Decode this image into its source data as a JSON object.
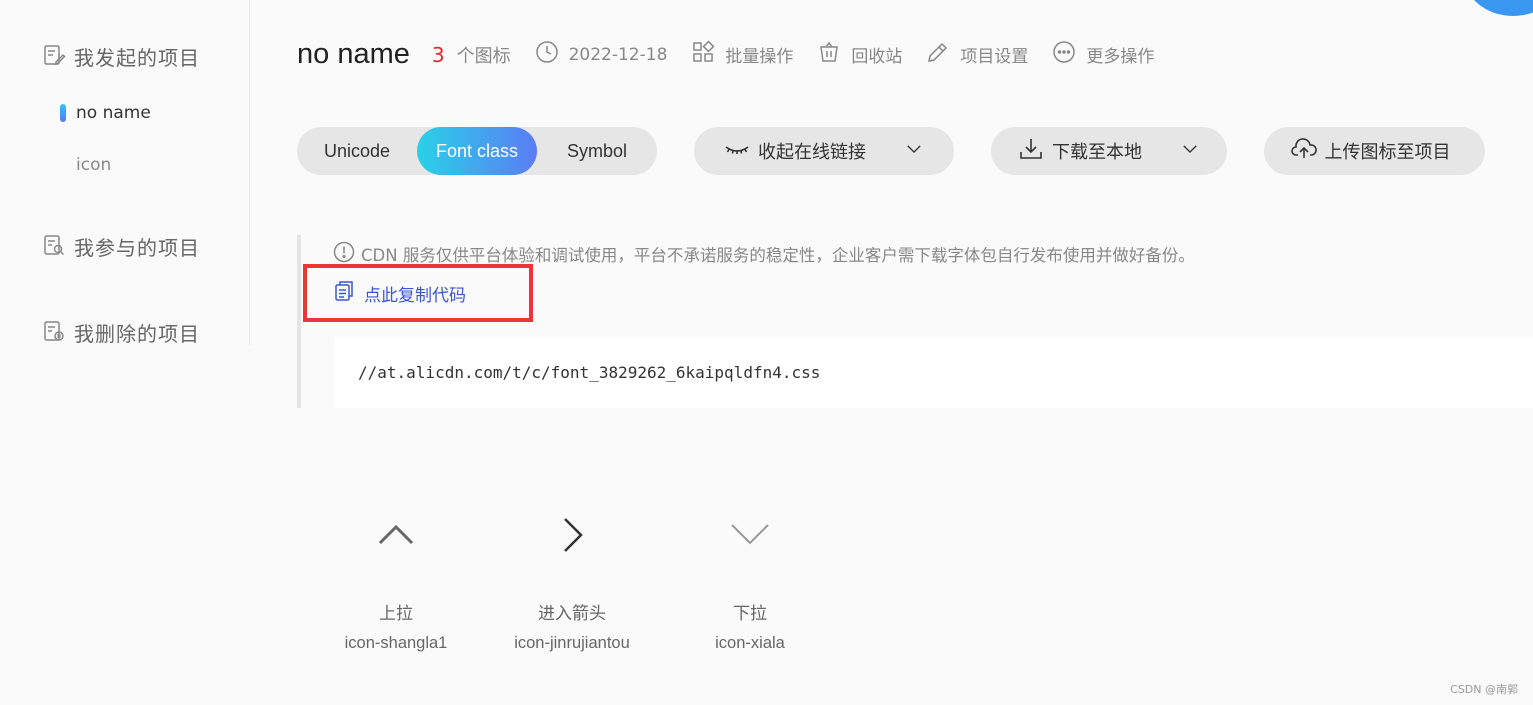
{
  "sidebar": {
    "my_projects": "我发起的项目",
    "items": [
      {
        "label": "no name",
        "active": true
      },
      {
        "label": "icon",
        "active": false
      }
    ],
    "joined_projects": "我参与的项目",
    "deleted_projects": "我删除的项目"
  },
  "header": {
    "project_name": "no name",
    "icon_count": "3",
    "icon_count_unit": "个图标",
    "date": "2022-12-18",
    "batch_ops": "批量操作",
    "recycle_bin": "回收站",
    "settings": "项目设置",
    "more_ops": "更多操作"
  },
  "tabs": [
    {
      "label": "Unicode",
      "selected": false
    },
    {
      "label": "Font class",
      "selected": true
    },
    {
      "label": "Symbol",
      "selected": false
    }
  ],
  "buttons": {
    "collapse_link": "收起在线链接",
    "download_local": "下载至本地",
    "upload_icons": "上传图标至项目"
  },
  "cdn": {
    "notice": "CDN 服务仅供平台体验和调试使用，平台不承诺服务的稳定性，企业客户需下载字体包自行发布使用并做好备份。",
    "copy_code": "点此复制代码",
    "url": "//at.alicdn.com/t/c/font_3829262_6kaipqldfn4.css"
  },
  "icons": [
    {
      "name": "上拉",
      "code": "icon-shangla1",
      "glyph": "chevron-up-icon"
    },
    {
      "name": "进入箭头",
      "code": "icon-jinrujiantou",
      "glyph": "chevron-right-icon"
    },
    {
      "name": "下拉",
      "code": "icon-xiala",
      "glyph": "chevron-down-icon"
    }
  ],
  "watermark": "CSDN @南郭",
  "colors": {
    "accent_gradient_start": "#2ad1e8",
    "accent_gradient_end": "#5b7cf5",
    "count_red": "#e42a2a",
    "link_blue": "#3a56d4",
    "highlight_red": "#e83737"
  }
}
